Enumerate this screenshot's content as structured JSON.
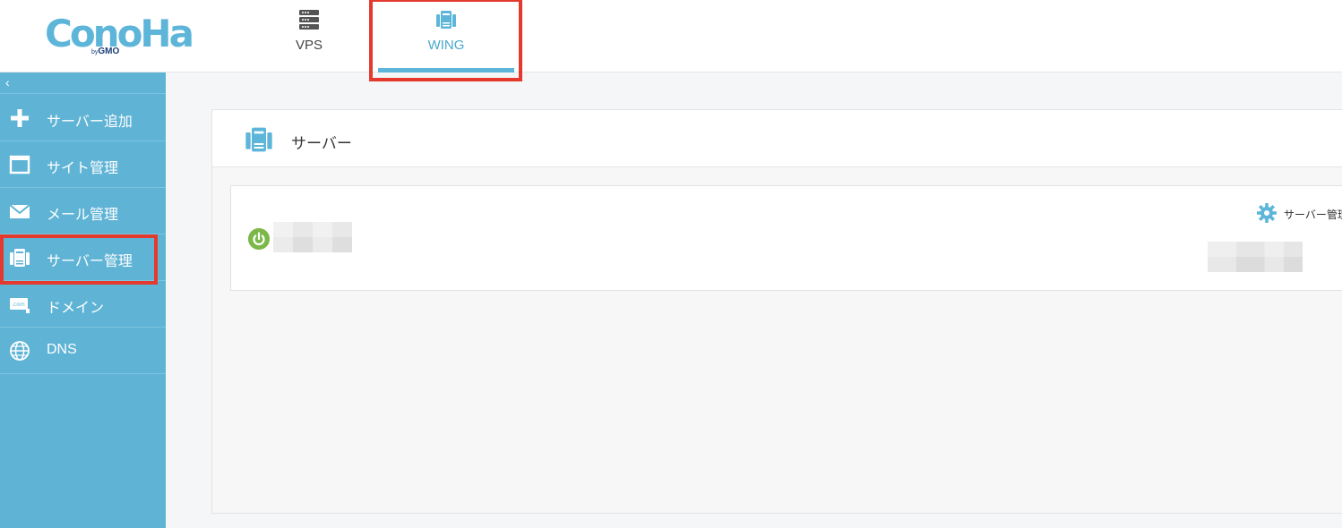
{
  "brand": {
    "logo_text": "ConoHa",
    "logo_sub_by": "by",
    "logo_sub": "GMO"
  },
  "topnav": {
    "tabs": [
      {
        "label": "VPS",
        "icon": "server-rack-icon",
        "active": false
      },
      {
        "label": "WING",
        "icon": "wing-server-icon",
        "active": true
      }
    ]
  },
  "sidebar": {
    "collapse_glyph": "‹",
    "items": [
      {
        "label": "サーバー追加",
        "icon": "plus-icon"
      },
      {
        "label": "サイト管理",
        "icon": "window-icon"
      },
      {
        "label": "メール管理",
        "icon": "envelope-icon"
      },
      {
        "label": "サーバー管理",
        "icon": "server-manage-icon",
        "highlighted": true
      },
      {
        "label": "ドメイン",
        "icon": "domain-com-icon"
      },
      {
        "label": "DNS",
        "icon": "globe-icon"
      }
    ]
  },
  "main": {
    "section_title": "サーバー",
    "server_card": {
      "status": "on",
      "manage_label": "サーバー管理"
    }
  },
  "colors": {
    "accent": "#5fb3d5",
    "highlight": "#e33a2d",
    "power_on": "#7cb848"
  }
}
